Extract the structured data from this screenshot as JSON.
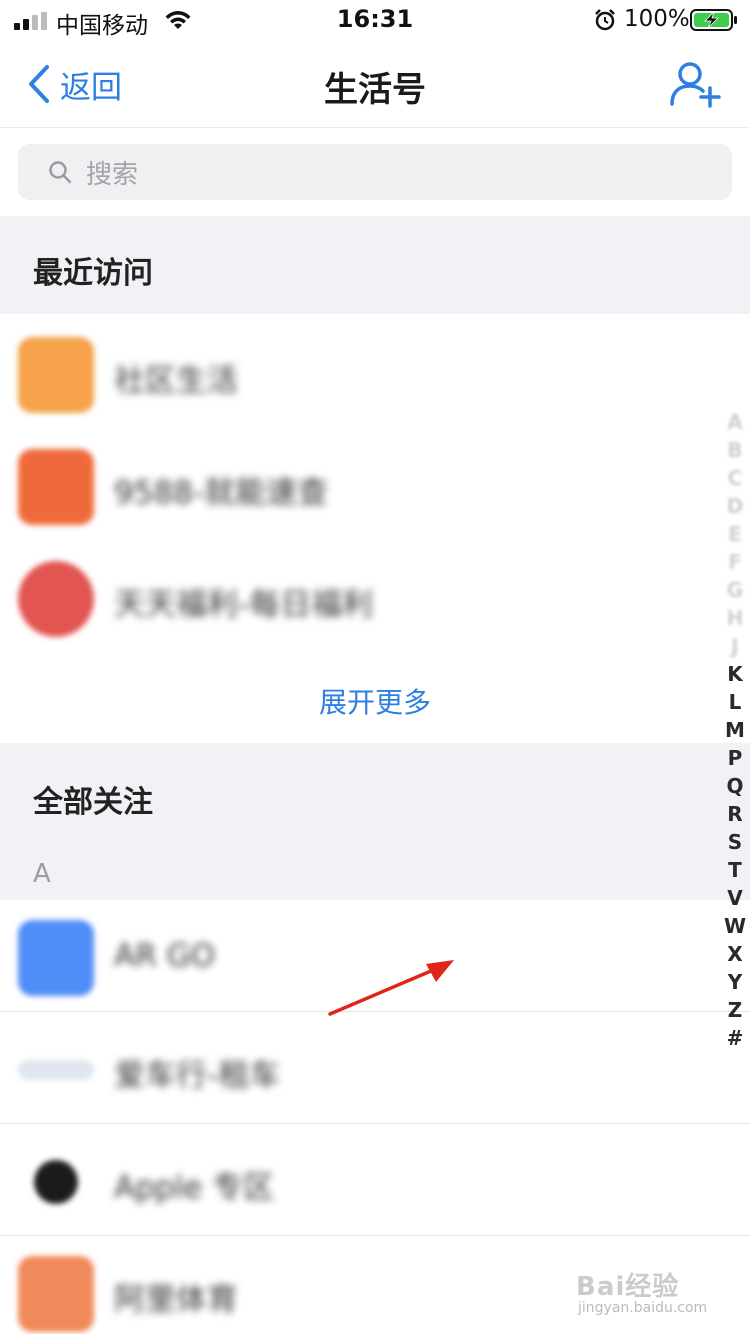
{
  "status_bar": {
    "carrier": "中国移动",
    "time": "16:31",
    "battery": "100%"
  },
  "nav": {
    "back_label": "返回",
    "title": "生活号"
  },
  "search": {
    "placeholder": "搜索"
  },
  "recent": {
    "title": "最近访问",
    "items": [
      {
        "name": "社区生活",
        "avatar_color": "#f5a24a"
      },
      {
        "name": "9588-就能速查",
        "avatar_color": "#ef6a3a"
      },
      {
        "name": "天天福利-每日福利",
        "avatar_color": "#e25550"
      }
    ],
    "expand_label": "展开更多"
  },
  "all_follows": {
    "title": "全部关注",
    "group_letter": "A",
    "items": [
      {
        "name": "AR GO",
        "avatar_color": "#4f8ef7"
      },
      {
        "name": "爱车行-租车",
        "avatar_color": "#dfe6ef"
      },
      {
        "name": "Apple 专区",
        "avatar_color": "#1b1b1b"
      },
      {
        "name": "阿里体育",
        "avatar_color": "#f08a5a"
      }
    ]
  },
  "index_bar": {
    "hidden_letters": [
      "A",
      "B",
      "C",
      "D",
      "E",
      "F",
      "G",
      "H",
      "J"
    ],
    "letters": [
      "K",
      "L",
      "M",
      "P",
      "Q",
      "R",
      "S",
      "T",
      "V",
      "W",
      "X",
      "Y",
      "Z",
      "#"
    ]
  },
  "watermark": {
    "brand": "Bai经验",
    "url": "jingyan.baidu.com"
  },
  "colors": {
    "accent": "#2d7fe0",
    "section_bg": "#f2f2f6",
    "annotation": "#e0251b"
  }
}
